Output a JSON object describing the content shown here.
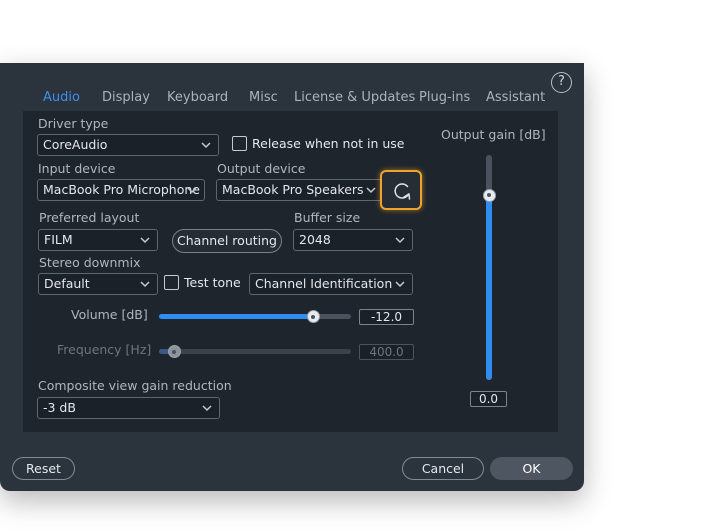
{
  "tabs": [
    {
      "label": "Audio",
      "active": true
    },
    {
      "label": "Display"
    },
    {
      "label": "Keyboard"
    },
    {
      "label": "Misc"
    },
    {
      "label": "License & Updates"
    },
    {
      "label": "Plug-ins"
    },
    {
      "label": "Assistant"
    }
  ],
  "help": {
    "glyph": "?"
  },
  "driver": {
    "label": "Driver type",
    "value": "CoreAudio"
  },
  "release": {
    "label": "Release when not in use",
    "checked": false
  },
  "input": {
    "label": "Input device",
    "value": "MacBook Pro Microphone"
  },
  "output": {
    "label": "Output device",
    "value": "MacBook Pro Speakers"
  },
  "refresh": {
    "icon": "refresh-icon"
  },
  "layout": {
    "label": "Preferred layout",
    "value": "FILM"
  },
  "routing": {
    "label": "Channel routing"
  },
  "buffer": {
    "label": "Buffer size",
    "value": "2048"
  },
  "downmix": {
    "label": "Stereo downmix",
    "value": "Default"
  },
  "test_tone": {
    "label": "Test tone",
    "checked": false,
    "signal": "Channel Identification"
  },
  "volume": {
    "label": "Volume [dB]",
    "value": "-12.0",
    "fraction": 0.8
  },
  "frequency": {
    "label": "Frequency [Hz]",
    "value": "400.0",
    "fraction": 0.08,
    "disabled": true
  },
  "composite": {
    "label": "Composite view gain reduction",
    "value": "-3 dB"
  },
  "output_gain": {
    "label": "Output gain [dB]",
    "value": "0.0",
    "fraction": 0.82
  },
  "footer": {
    "reset": "Reset",
    "cancel": "Cancel",
    "ok": "OK"
  },
  "colors": {
    "accent": "#2f8cf0",
    "highlight": "#f0a32a",
    "background": "#2b333c"
  }
}
